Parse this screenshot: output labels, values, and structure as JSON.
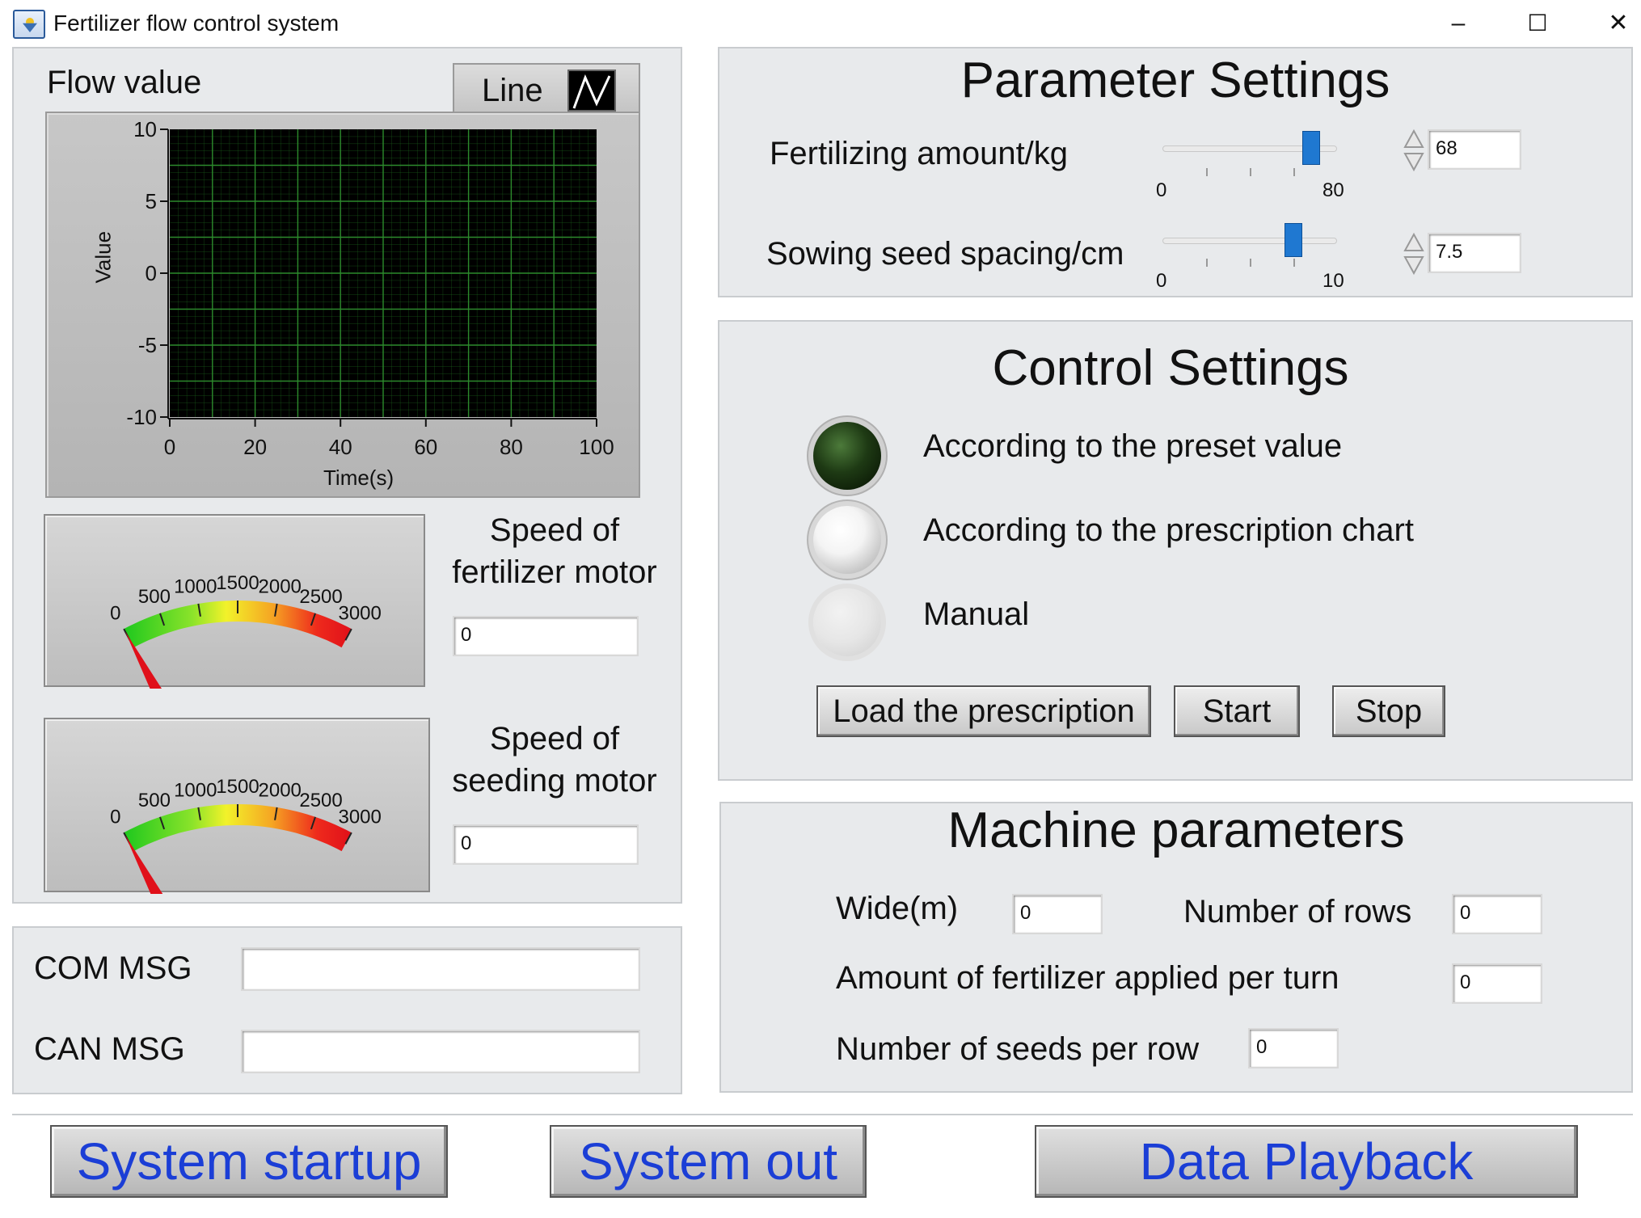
{
  "window": {
    "title": "Fertilizer flow control system",
    "controls": {
      "minimize": "–",
      "maximize": "☐",
      "close": "✕"
    }
  },
  "graph": {
    "title": "Flow value",
    "plot_legend_label": "Line",
    "ylabel": "Value",
    "xlabel": "Time(s)",
    "y_ticks": [
      "10",
      "5",
      "0",
      "-5",
      "-10"
    ],
    "x_ticks": [
      "0",
      "20",
      "40",
      "60",
      "80",
      "100"
    ],
    "colors": {
      "plot_bg": "#000000",
      "grid": "#1f6e1f"
    }
  },
  "chart_data": {
    "type": "line",
    "xlabel": "Time(s)",
    "ylabel": "Value",
    "xlim": [
      0,
      100
    ],
    "ylim": [
      -10,
      10
    ],
    "series": [],
    "grid": true
  },
  "gauges": [
    {
      "label": "Speed of fertilizer motor",
      "label_line1": "Speed of",
      "label_line2": "fertilizer motor",
      "value": "0",
      "min": 0,
      "max": 3000,
      "ticks": [
        "0",
        "500",
        "1000",
        "1500",
        "2000",
        "2500",
        "3000"
      ]
    },
    {
      "label": "Speed of seeding motor",
      "label_line1": "Speed of",
      "label_line2": "seeding motor",
      "value": "0",
      "min": 0,
      "max": 3000,
      "ticks": [
        "0",
        "500",
        "1000",
        "1500",
        "2000",
        "2500",
        "3000"
      ]
    }
  ],
  "messages": {
    "com_label": "COM MSG",
    "com_value": "",
    "can_label": "CAN MSG",
    "can_value": ""
  },
  "parameter_settings": {
    "title": "Parameter Settings",
    "fertilizing": {
      "label": "Fertilizing amount/kg",
      "min_label": "0",
      "max_label": "80",
      "min": 0,
      "max": 80,
      "value": 68,
      "value_text": "68"
    },
    "spacing": {
      "label": "Sowing seed spacing/cm",
      "min_label": "0",
      "max_label": "10",
      "min": 0,
      "max": 10,
      "value": 7.5,
      "value_text": "7.5"
    }
  },
  "control_settings": {
    "title": "Control Settings",
    "options": [
      {
        "label": "According to the preset value",
        "state": "on"
      },
      {
        "label": "According to the prescription chart",
        "state": "off"
      },
      {
        "label": "Manual",
        "state": "disabled"
      }
    ],
    "buttons": {
      "load": "Load the prescription",
      "start": "Start",
      "stop": "Stop"
    }
  },
  "machine_parameters": {
    "title": "Machine parameters",
    "wide_label": "Wide(m)",
    "wide_value": "0",
    "rows_label": "Number of rows",
    "rows_value": "0",
    "amount_label": "Amount of fertilizer applied per turn",
    "amount_value": "0",
    "seeds_label": "Number of seeds per row",
    "seeds_value": "0"
  },
  "bottom_buttons": {
    "startup": "System startup",
    "out": "System out",
    "playback": "Data Playback"
  },
  "colors": {
    "accent_text": "#1b3ed6",
    "slider_thumb": "#1f78d1",
    "led_on": "#1e3a14"
  }
}
